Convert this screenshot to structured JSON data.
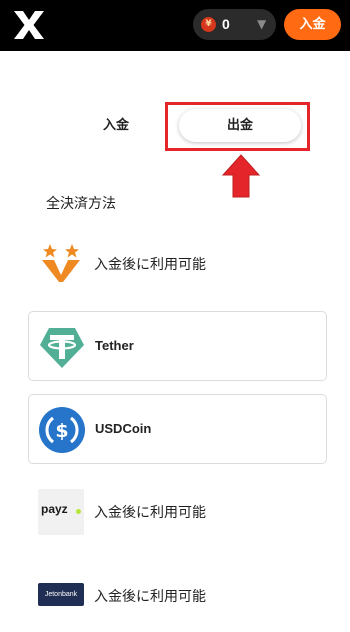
{
  "header": {
    "balance": {
      "currency_symbol": "¥",
      "value": "0"
    },
    "deposit_button": "入金"
  },
  "tabs": [
    {
      "label": "入金",
      "active": false
    },
    {
      "label": "出金",
      "active": true
    }
  ],
  "section_title": "全決済方法",
  "payment_methods": [
    {
      "name": "",
      "status_text": "入金後に利用可能",
      "icon": "star-v-logo-icon"
    },
    {
      "name": "Tether",
      "status_text": "",
      "icon": "tether-icon"
    },
    {
      "name": "USDCoin",
      "status_text": "",
      "icon": "usdc-icon"
    },
    {
      "name": "",
      "logo_text": "payz",
      "status_text": "入金後に利用可能",
      "icon": "payz-logo-icon"
    },
    {
      "name": "",
      "logo_text": "Jetonbank",
      "status_text": "入金後に利用可能",
      "icon": "jetonbank-logo-icon"
    }
  ],
  "colors": {
    "brand_orange": "#ff6a13",
    "highlight_red": "#e4262a",
    "tether_green": "#50af95",
    "usdc_blue": "#2775ca"
  }
}
